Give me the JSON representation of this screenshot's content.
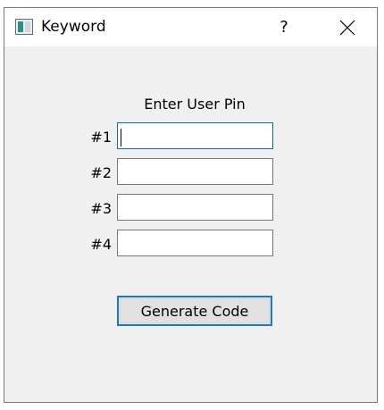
{
  "window": {
    "title": "Keyword",
    "help_label": "?",
    "icons": {
      "app": "app-window-icon",
      "close": "close-icon"
    }
  },
  "form": {
    "prompt": "Enter User Pin",
    "fields": [
      {
        "label": "#1",
        "value": "",
        "focused": true
      },
      {
        "label": "#2",
        "value": ""
      },
      {
        "label": "#3",
        "value": ""
      },
      {
        "label": "#4",
        "value": ""
      }
    ],
    "button_label": "Generate Code"
  },
  "colors": {
    "window_bg": "#f0f0f0",
    "focus_border": "#0f6ca8",
    "button_border": "#1c7ab4",
    "button_bg": "#e1e1e1"
  }
}
